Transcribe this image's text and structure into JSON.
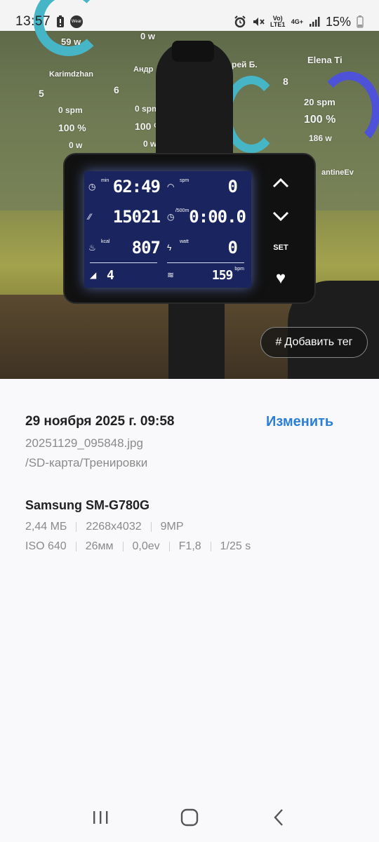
{
  "status_bar": {
    "time": "13:57",
    "left_icons": [
      "battery-alert-icon",
      "wear-icon"
    ],
    "wear_label": "Wear",
    "right_icons": [
      "alarm-icon",
      "mute-icon",
      "volte-icon",
      "4g-icon",
      "signal-icon"
    ],
    "volte_label": "Vo) LTE1",
    "net_label": "4G+",
    "battery": "15%"
  },
  "photo": {
    "projection": {
      "names": [
        "Karimdzhan",
        "Андр",
        "рей Б.",
        "Elena Ti",
        "antineEv"
      ],
      "numbers": [
        "5",
        "6",
        "8"
      ],
      "watts_top": "59 w",
      "zero_w": "0 w",
      "spm_zero": "0 spm",
      "pct_100": "100 %",
      "spm_20": "20 spm",
      "w_186": "186 w",
      "pct_top": "100 %"
    },
    "monitor": {
      "time_unit": "min",
      "time_value": "62:49",
      "spm_unit": "spm",
      "spm_value": "0",
      "distance_value": "15021",
      "split_unit": "/500m",
      "split_value": "0:00.0",
      "kcal_unit": "kcal",
      "kcal_value": "807",
      "watt_unit": "watt",
      "watt_value": "0",
      "level_value": "4",
      "heart_value": "159",
      "heart_unit": "bpm",
      "button_up": "⌃",
      "button_down": "⌄",
      "button_set": "SET",
      "button_heart": "♥"
    },
    "add_tag_label": "Добавить тег",
    "add_tag_hash": "#"
  },
  "details": {
    "datetime": "29 ноября 2025 г. 09:58",
    "edit_label": "Изменить",
    "filename": "20251129_095848.jpg",
    "path": "/SD-карта/Тренировки",
    "device": "Samsung SM-G780G",
    "row1": [
      "2,44 МБ",
      "2268x4032",
      "9MP"
    ],
    "row2": [
      "ISO 640",
      "26мм",
      "0,0ev",
      "F1,8",
      "1/25 s"
    ]
  },
  "nav": {
    "icons": [
      "recents-icon",
      "home-icon",
      "back-icon"
    ]
  }
}
